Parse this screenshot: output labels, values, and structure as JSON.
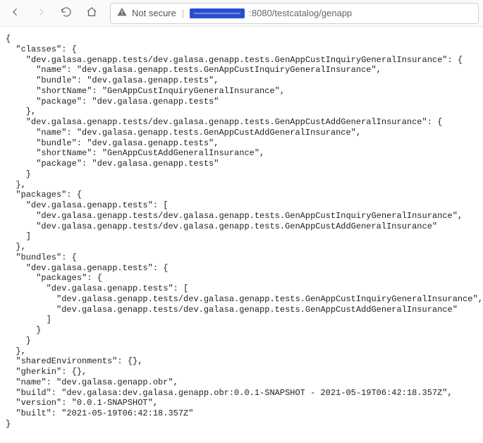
{
  "toolbar": {
    "not_secure_label": "Not secure",
    "url_suffix": ":8080/testcatalog/genapp"
  },
  "json_text": "{\n  \"classes\": {\n    \"dev.galasa.genapp.tests/dev.galasa.genapp.tests.GenAppCustInquiryGeneralInsurance\": {\n      \"name\": \"dev.galasa.genapp.tests.GenAppCustInquiryGeneralInsurance\",\n      \"bundle\": \"dev.galasa.genapp.tests\",\n      \"shortName\": \"GenAppCustInquiryGeneralInsurance\",\n      \"package\": \"dev.galasa.genapp.tests\"\n    },\n    \"dev.galasa.genapp.tests/dev.galasa.genapp.tests.GenAppCustAddGeneralInsurance\": {\n      \"name\": \"dev.galasa.genapp.tests.GenAppCustAddGeneralInsurance\",\n      \"bundle\": \"dev.galasa.genapp.tests\",\n      \"shortName\": \"GenAppCustAddGeneralInsurance\",\n      \"package\": \"dev.galasa.genapp.tests\"\n    }\n  },\n  \"packages\": {\n    \"dev.galasa.genapp.tests\": [\n      \"dev.galasa.genapp.tests/dev.galasa.genapp.tests.GenAppCustInquiryGeneralInsurance\",\n      \"dev.galasa.genapp.tests/dev.galasa.genapp.tests.GenAppCustAddGeneralInsurance\"\n    ]\n  },\n  \"bundles\": {\n    \"dev.galasa.genapp.tests\": {\n      \"packages\": {\n        \"dev.galasa.genapp.tests\": [\n          \"dev.galasa.genapp.tests/dev.galasa.genapp.tests.GenAppCustInquiryGeneralInsurance\",\n          \"dev.galasa.genapp.tests/dev.galasa.genapp.tests.GenAppCustAddGeneralInsurance\"\n        ]\n      }\n    }\n  },\n  \"sharedEnvironments\": {},\n  \"gherkin\": {},\n  \"name\": \"dev.galasa.genapp.obr\",\n  \"build\": \"dev.galasa:dev.galasa.genapp.obr:0.0.1-SNAPSHOT - 2021-05-19T06:42:18.357Z\",\n  \"version\": \"0.0.1-SNAPSHOT\",\n  \"built\": \"2021-05-19T06:42:18.357Z\"\n}"
}
